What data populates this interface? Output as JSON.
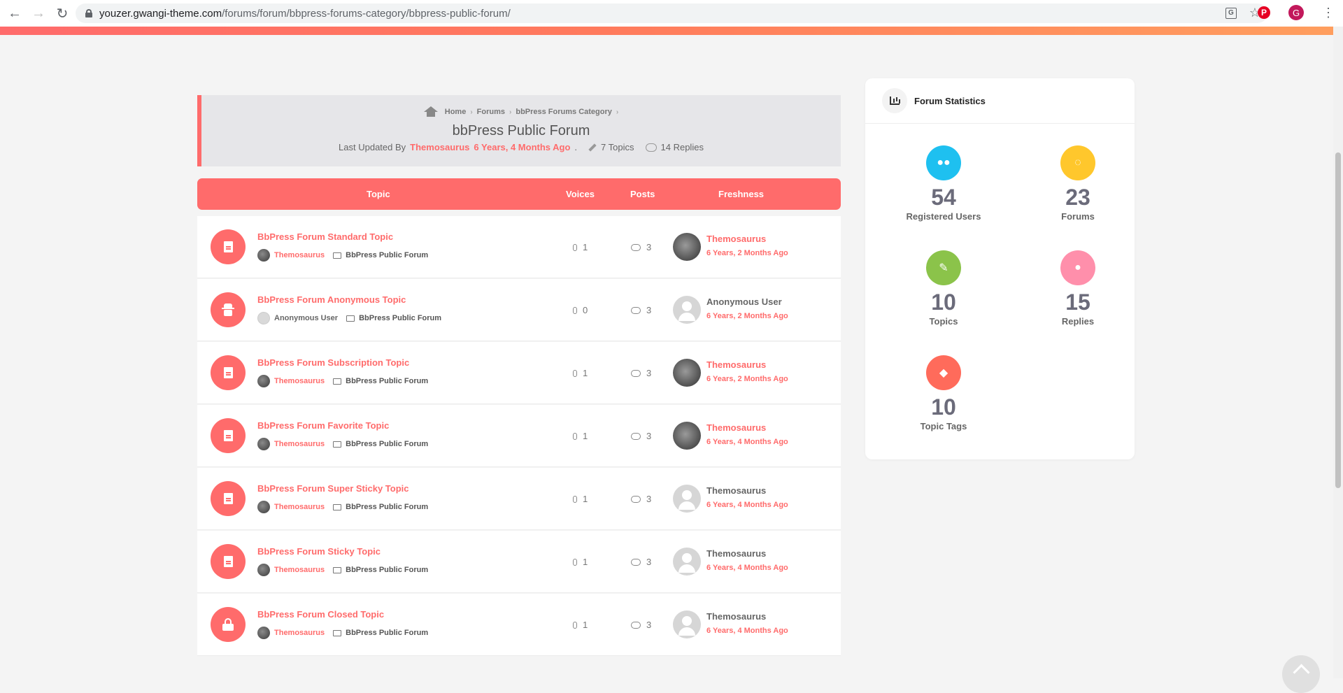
{
  "browser": {
    "url_host": "youzer.gwangi-theme.com",
    "url_path": "/forums/forum/bbpress-forums-category/bbpress-public-forum/",
    "profile_initial": "G"
  },
  "breadcrumb": {
    "items": [
      "Home",
      "Forums",
      "bbPress Forums Category"
    ]
  },
  "forum": {
    "title": "bbPress Public Forum",
    "last_updated_prefix": "Last Updated By",
    "last_updated_author": "Themosaurus",
    "last_updated_time": "6 Years, 4 Months Ago",
    "topics_count": "7 Topics",
    "replies_count": "14 Replies"
  },
  "table": {
    "headers": {
      "topic": "Topic",
      "voices": "Voices",
      "posts": "Posts",
      "freshness": "Freshness"
    },
    "rows": [
      {
        "icon": "document-icon",
        "title": "BbPress Forum Standard Topic",
        "author": "Themosaurus",
        "forum": "BbPress Public Forum",
        "voices": "1",
        "posts": "3",
        "fresh_author": "Themosaurus",
        "fresh_time": "6 Years, 2 Months Ago"
      },
      {
        "icon": "spy-icon",
        "title": "BbPress Forum Anonymous Topic",
        "author": "Anonymous User",
        "forum": "BbPress Public Forum",
        "voices": "0",
        "posts": "3",
        "fresh_author": "Anonymous User",
        "fresh_time": "6 Years, 2 Months Ago"
      },
      {
        "icon": "document-icon",
        "title": "BbPress Forum Subscription Topic",
        "author": "Themosaurus",
        "forum": "BbPress Public Forum",
        "voices": "1",
        "posts": "3",
        "fresh_author": "Themosaurus",
        "fresh_time": "6 Years, 2 Months Ago"
      },
      {
        "icon": "document-icon",
        "title": "BbPress Forum Favorite Topic",
        "author": "Themosaurus",
        "forum": "BbPress Public Forum",
        "voices": "1",
        "posts": "3",
        "fresh_author": "Themosaurus",
        "fresh_time": "6 Years, 4 Months Ago"
      },
      {
        "icon": "document-icon",
        "title": "BbPress Forum Super Sticky Topic",
        "author": "Themosaurus",
        "forum": "BbPress Public Forum",
        "voices": "1",
        "posts": "3",
        "fresh_author": "Themosaurus",
        "fresh_time": "6 Years, 4 Months Ago"
      },
      {
        "icon": "document-icon",
        "title": "BbPress Forum Sticky Topic",
        "author": "Themosaurus",
        "forum": "BbPress Public Forum",
        "voices": "1",
        "posts": "3",
        "fresh_author": "Themosaurus",
        "fresh_time": "6 Years, 4 Months Ago"
      },
      {
        "icon": "lock-icon",
        "title": "BbPress Forum Closed Topic",
        "author": "Themosaurus",
        "forum": "BbPress Public Forum",
        "voices": "1",
        "posts": "3",
        "fresh_author": "Themosaurus",
        "fresh_time": "6 Years, 4 Months Ago"
      }
    ]
  },
  "widget": {
    "title": "Forum Statistics",
    "stats": [
      {
        "value": "54",
        "label": "Registered Users",
        "color": "#1ec0f0",
        "icon": "users-icon"
      },
      {
        "value": "23",
        "label": "Forums",
        "color": "#ffc72c",
        "icon": "comments-icon"
      },
      {
        "value": "10",
        "label": "Topics",
        "color": "#8bc34a",
        "icon": "pencil-icon"
      },
      {
        "value": "15",
        "label": "Replies",
        "color": "#ff8fab",
        "icon": "comment-icon"
      },
      {
        "value": "10",
        "label": "Topic Tags",
        "color": "#ff6b5b",
        "icon": "tags-icon"
      }
    ]
  },
  "colors": {
    "accent": "#ff6b6b",
    "header_bg": "#e6e6e9",
    "page_bg": "#f4f4f4"
  }
}
